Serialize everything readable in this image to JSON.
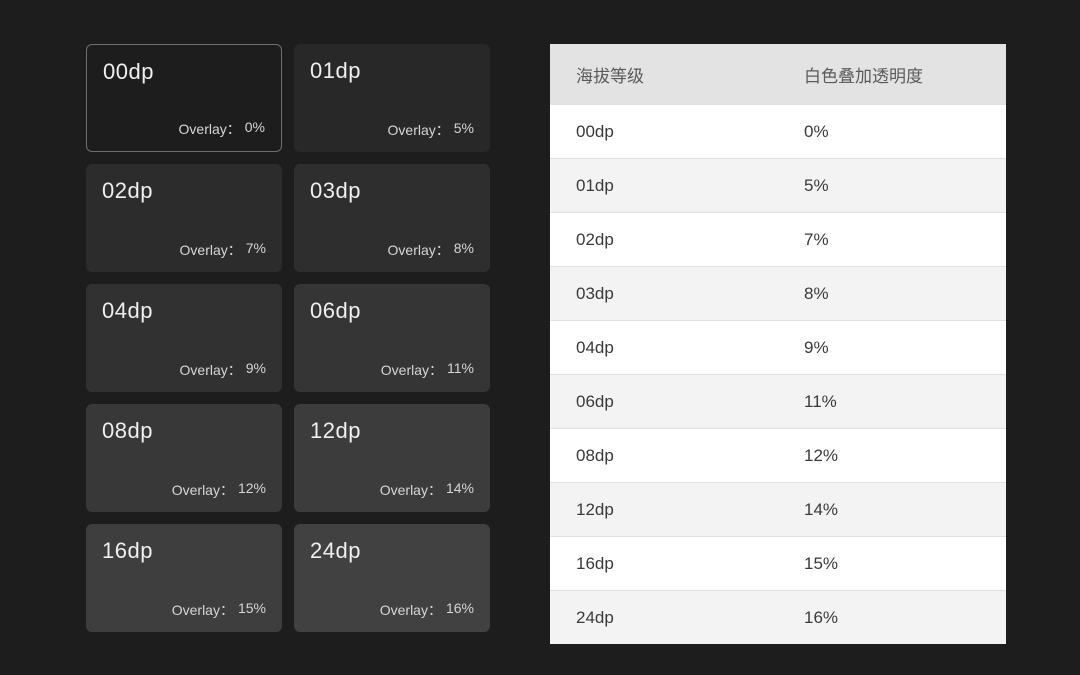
{
  "overlay_label": "Overlay：",
  "cards": [
    {
      "dp": "00dp",
      "overlay": "0%",
      "opacity": 0
    },
    {
      "dp": "01dp",
      "overlay": "5%",
      "opacity": 0.05
    },
    {
      "dp": "02dp",
      "overlay": "7%",
      "opacity": 0.07
    },
    {
      "dp": "03dp",
      "overlay": "8%",
      "opacity": 0.08
    },
    {
      "dp": "04dp",
      "overlay": "9%",
      "opacity": 0.09
    },
    {
      "dp": "06dp",
      "overlay": "11%",
      "opacity": 0.11
    },
    {
      "dp": "08dp",
      "overlay": "12%",
      "opacity": 0.12
    },
    {
      "dp": "12dp",
      "overlay": "14%",
      "opacity": 0.14
    },
    {
      "dp": "16dp",
      "overlay": "15%",
      "opacity": 0.15
    },
    {
      "dp": "24dp",
      "overlay": "16%",
      "opacity": 0.16
    }
  ],
  "table_headers": {
    "elevation": "海拔等级",
    "overlay": "白色叠加透明度"
  },
  "table_rows": [
    {
      "dp": "00dp",
      "overlay": "0%"
    },
    {
      "dp": "01dp",
      "overlay": "5%"
    },
    {
      "dp": "02dp",
      "overlay": "7%"
    },
    {
      "dp": "03dp",
      "overlay": "8%"
    },
    {
      "dp": "04dp",
      "overlay": "9%"
    },
    {
      "dp": "06dp",
      "overlay": "11%"
    },
    {
      "dp": "08dp",
      "overlay": "12%"
    },
    {
      "dp": "12dp",
      "overlay": "14%"
    },
    {
      "dp": "16dp",
      "overlay": "15%"
    },
    {
      "dp": "24dp",
      "overlay": "16%"
    }
  ],
  "chart_data": {
    "type": "table",
    "title": "Elevation vs. white overlay opacity",
    "columns": [
      "Elevation (dp)",
      "White overlay opacity (%)"
    ],
    "rows": [
      [
        0,
        0
      ],
      [
        1,
        5
      ],
      [
        2,
        7
      ],
      [
        3,
        8
      ],
      [
        4,
        9
      ],
      [
        6,
        11
      ],
      [
        8,
        12
      ],
      [
        12,
        14
      ],
      [
        16,
        15
      ],
      [
        24,
        16
      ]
    ]
  }
}
